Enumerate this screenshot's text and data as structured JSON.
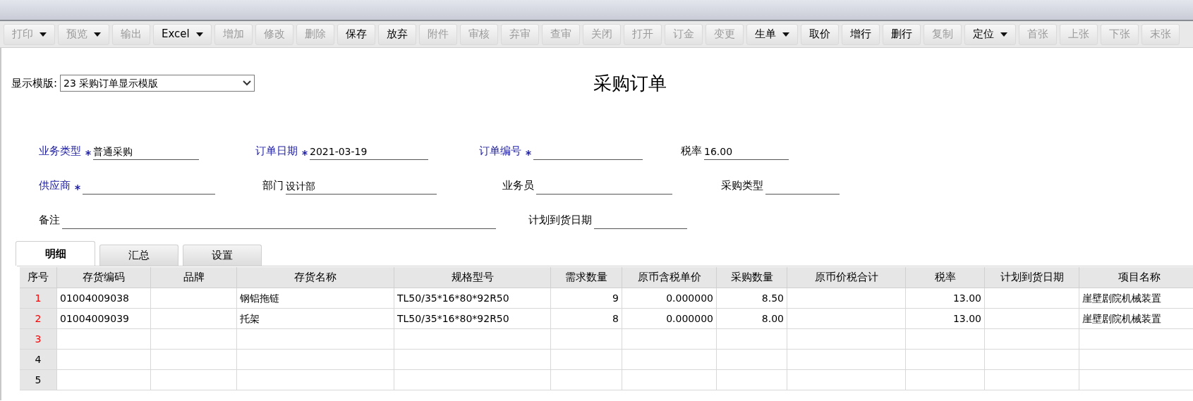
{
  "toolbar": [
    {
      "label": "打印",
      "enabled": false,
      "dropdown": true
    },
    {
      "label": "预览",
      "enabled": false,
      "dropdown": true
    },
    {
      "label": "输出",
      "enabled": false,
      "dropdown": false
    },
    {
      "label": "Excel",
      "enabled": true,
      "dropdown": true
    },
    {
      "label": "增加",
      "enabled": false,
      "dropdown": false
    },
    {
      "label": "修改",
      "enabled": false,
      "dropdown": false
    },
    {
      "label": "删除",
      "enabled": false,
      "dropdown": false
    },
    {
      "label": "保存",
      "enabled": true,
      "dropdown": false
    },
    {
      "label": "放弃",
      "enabled": true,
      "dropdown": false
    },
    {
      "label": "附件",
      "enabled": false,
      "dropdown": false
    },
    {
      "label": "审核",
      "enabled": false,
      "dropdown": false
    },
    {
      "label": "弃审",
      "enabled": false,
      "dropdown": false
    },
    {
      "label": "查审",
      "enabled": false,
      "dropdown": false
    },
    {
      "label": "关闭",
      "enabled": false,
      "dropdown": false
    },
    {
      "label": "打开",
      "enabled": false,
      "dropdown": false
    },
    {
      "label": "订金",
      "enabled": false,
      "dropdown": false
    },
    {
      "label": "变更",
      "enabled": false,
      "dropdown": false
    },
    {
      "label": "生单",
      "enabled": true,
      "dropdown": true
    },
    {
      "label": "取价",
      "enabled": true,
      "dropdown": false
    },
    {
      "label": "增行",
      "enabled": true,
      "dropdown": false
    },
    {
      "label": "删行",
      "enabled": true,
      "dropdown": false
    },
    {
      "label": "复制",
      "enabled": false,
      "dropdown": false
    },
    {
      "label": "定位",
      "enabled": true,
      "dropdown": true
    },
    {
      "label": "首张",
      "enabled": false,
      "dropdown": false
    },
    {
      "label": "上张",
      "enabled": false,
      "dropdown": false
    },
    {
      "label": "下张",
      "enabled": false,
      "dropdown": false
    },
    {
      "label": "末张",
      "enabled": false,
      "dropdown": false
    }
  ],
  "template": {
    "label": "显示模版:",
    "value": "23 采购订单显示模版"
  },
  "title": "采购订单",
  "fields": [
    [
      {
        "label": "业务类型",
        "required": true,
        "value": "普通采购"
      },
      {
        "label": "订单日期",
        "required": true,
        "value": "2021-03-19"
      },
      {
        "label": "订单编号",
        "required": true
      },
      {
        "label": "税率",
        "required": false,
        "value": "16.00"
      }
    ],
    [
      {
        "label": "供应商",
        "required": true
      },
      {
        "label": "部门",
        "required": false,
        "value": "设计部"
      },
      {
        "label": "业务员",
        "required": false
      },
      {
        "label": "采购类型",
        "required": false
      }
    ],
    [
      {
        "label": "备注",
        "required": false
      },
      {
        "label": "计划到货日期",
        "required": false
      }
    ]
  ],
  "tabs": [
    {
      "label": "明细",
      "selected": true
    },
    {
      "label": "汇总",
      "selected": false
    },
    {
      "label": "设置",
      "selected": false
    }
  ],
  "table": {
    "columns": [
      {
        "label": "序号",
        "kind": "index"
      },
      {
        "label": "存货编码",
        "kind": "text"
      },
      {
        "label": "品牌",
        "kind": "text"
      },
      {
        "label": "存货名称",
        "kind": "text"
      },
      {
        "label": "规格型号",
        "kind": "text"
      },
      {
        "label": "需求数量",
        "kind": "number"
      },
      {
        "label": "原币含税单价",
        "kind": "number"
      },
      {
        "label": "采购数量",
        "kind": "number"
      },
      {
        "label": "原币价税合计",
        "kind": "number"
      },
      {
        "label": "税率",
        "kind": "number"
      },
      {
        "label": "计划到货日期",
        "kind": "text"
      },
      {
        "label": "项目名称",
        "kind": "text"
      }
    ],
    "rows": [
      {
        "number": "1",
        "color": "#ff0000",
        "cells": [
          "01004009038",
          null,
          "钢铝拖链",
          "TL50/35*16*80*92R50",
          "9",
          "0.000000",
          "8.50",
          null,
          "13.00",
          null,
          "崖壁剧院机械装置"
        ]
      },
      {
        "number": "2",
        "color": "#ff0000",
        "cells": [
          "01004009039",
          null,
          "托架",
          "TL50/35*16*80*92R50",
          "8",
          "0.000000",
          "8.00",
          null,
          "13.00",
          null,
          "崖壁剧院机械装置"
        ]
      },
      {
        "number": "3",
        "color": "#ff0000"
      },
      {
        "number": "4",
        "color": "#000000"
      },
      {
        "number": "5",
        "color": "#000000"
      }
    ]
  }
}
